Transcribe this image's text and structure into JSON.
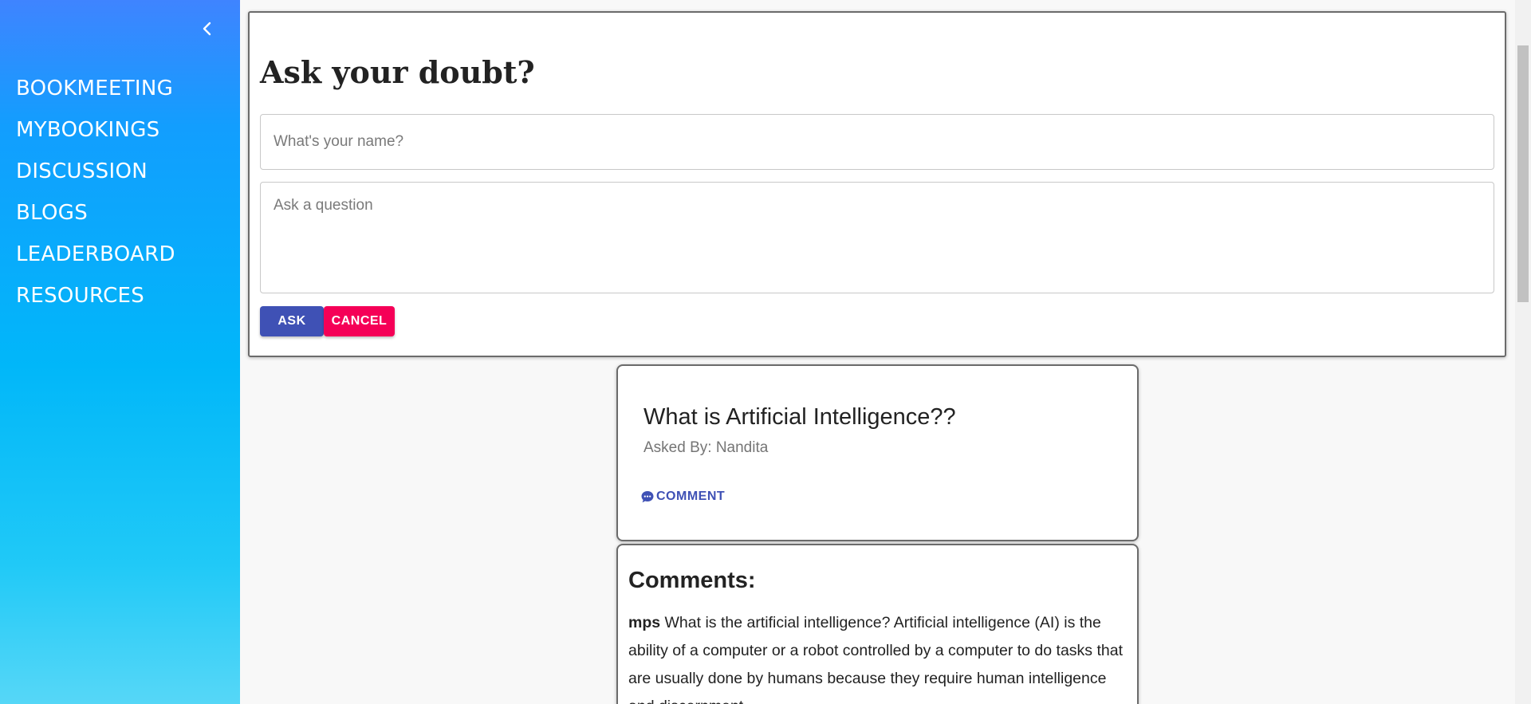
{
  "sidebar": {
    "collapse_icon": "chevron-left-icon",
    "items": [
      {
        "label": "BOOKMEETING"
      },
      {
        "label": "MYBOOKINGS"
      },
      {
        "label": "DISCUSSION"
      },
      {
        "label": "BLOGS"
      },
      {
        "label": "LEADERBOARD"
      },
      {
        "label": "RESOURCES"
      }
    ]
  },
  "ask_form": {
    "title": "Ask your doubt?",
    "name_placeholder": "What's your name?",
    "name_value": "",
    "question_placeholder": "Ask a question",
    "question_value": "",
    "ask_label": "ASK",
    "cancel_label": "CANCEL"
  },
  "question": {
    "title": "What is Artificial Intelligence??",
    "asked_by": "Asked By: Nandita",
    "comment_icon": "comment-icon",
    "comment_label": "COMMENT"
  },
  "comments": {
    "heading": "Comments:",
    "items": [
      {
        "author": "mps",
        "text": "What is the artificial intelligence? Artificial intelligence (AI) is the ability of a computer or a robot controlled by a computer to do tasks that are usually done by humans because they require human intelligence and discernment."
      }
    ]
  },
  "colors": {
    "primary": "#3f51b5",
    "secondary": "#f50057",
    "sidebar_gradient_top": "#3f84ff",
    "sidebar_gradient_bottom": "#56d7f7"
  }
}
